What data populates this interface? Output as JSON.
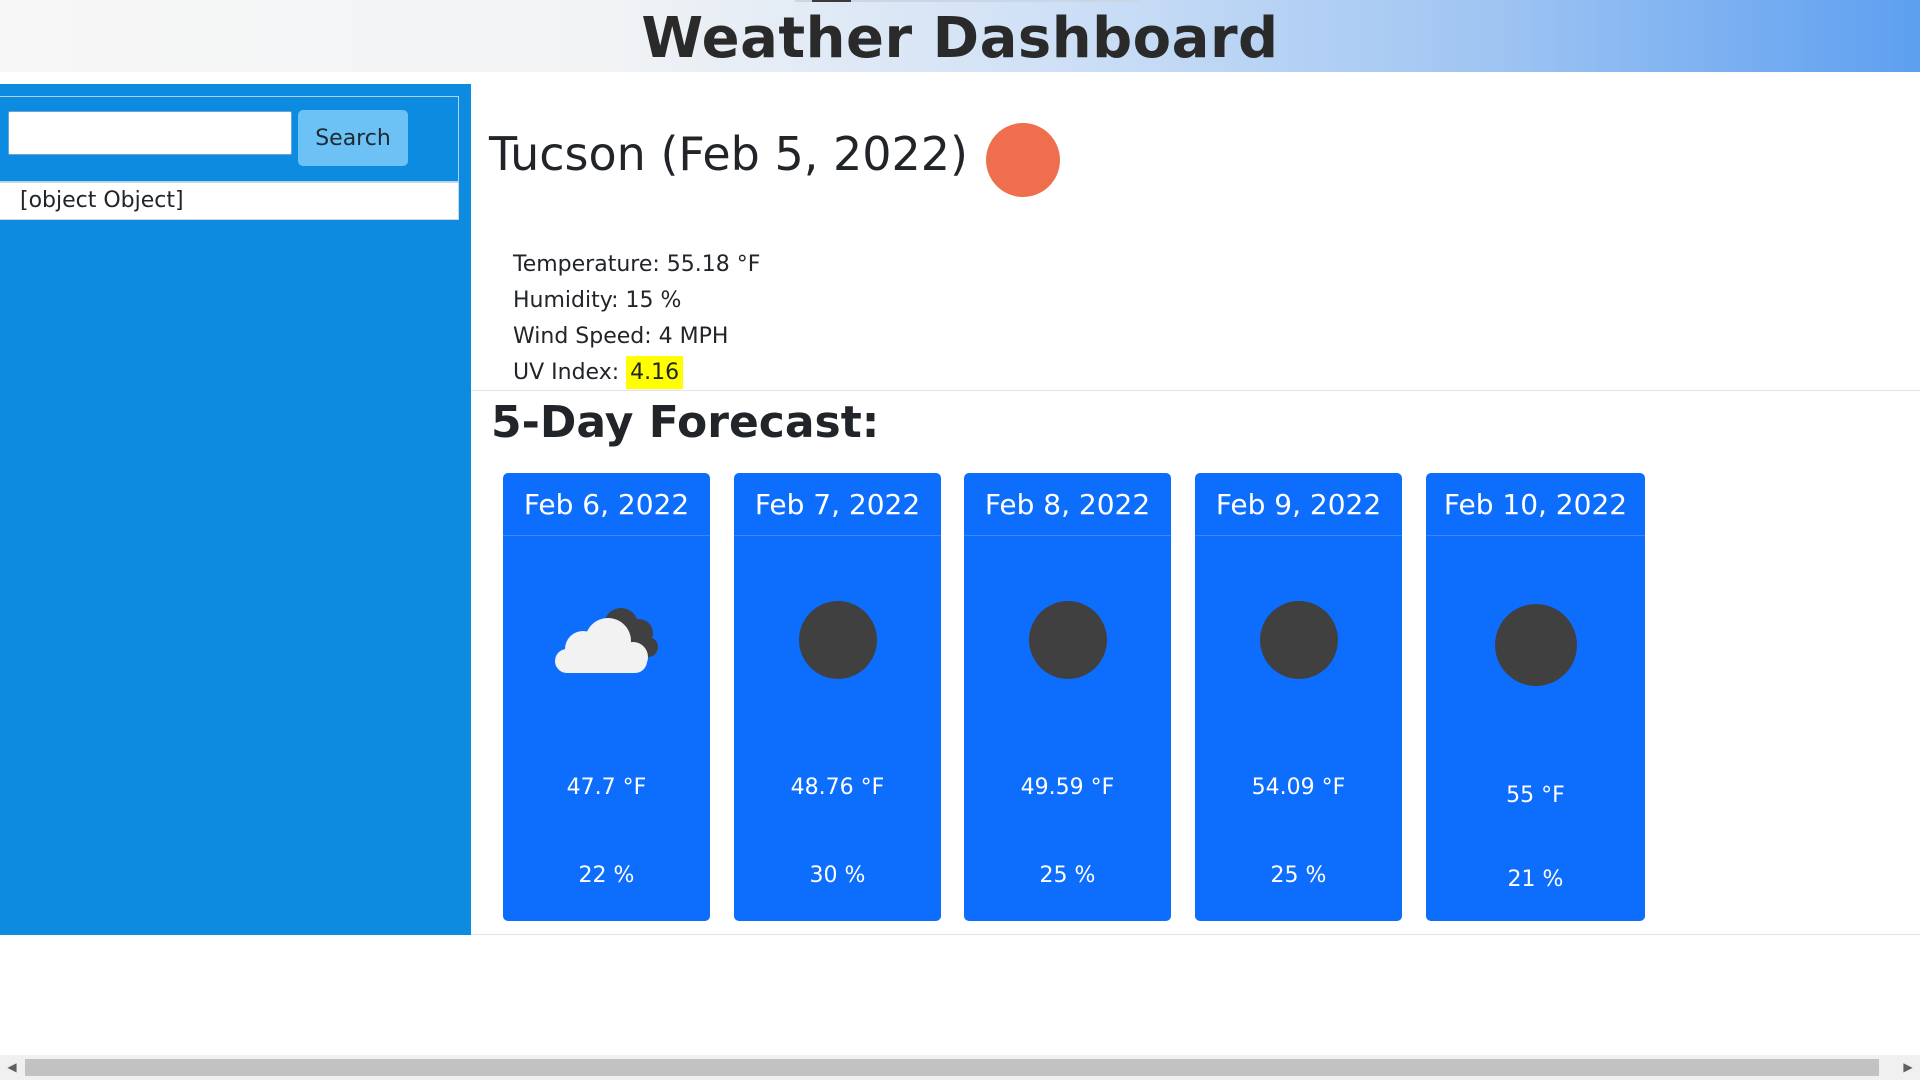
{
  "header": {
    "title": "Weather Dashboard"
  },
  "sidebar": {
    "search": {
      "value": "",
      "placeholder": "",
      "button_label": "Search"
    },
    "history": [
      {
        "label": "[object Object]"
      }
    ]
  },
  "current": {
    "title": "Tucson (Feb 5, 2022)",
    "icon": "sun-icon",
    "icon_color": "#ee6e4d",
    "temperature": "Temperature: 55.18 °F",
    "humidity": "Humidity: 15 %",
    "wind": "Wind Speed: 4 MPH",
    "uv_label": "UV Index: ",
    "uv_value": "4.16",
    "uv_color": "#ffff00"
  },
  "forecast": {
    "heading": "5-Day Forecast:",
    "card_color": "#0d6efd",
    "days": [
      {
        "date": "Feb 6, 2022",
        "icon": "cloudy-icon",
        "temp": "47.7 °F",
        "humidity": "22 %"
      },
      {
        "date": "Feb 7, 2022",
        "icon": "night-icon",
        "temp": "48.76 °F",
        "humidity": "30 %"
      },
      {
        "date": "Feb 8, 2022",
        "icon": "night-icon",
        "temp": "49.59 °F",
        "humidity": "25 %"
      },
      {
        "date": "Feb 9, 2022",
        "icon": "night-icon",
        "temp": "54.09 °F",
        "humidity": "25 %"
      },
      {
        "date": "Feb 10, 2022",
        "icon": "night-icon",
        "temp": "55 °F",
        "humidity": "21 %"
      }
    ]
  },
  "scrollbar": {
    "left_arrow": "◀",
    "right_arrow": "▶"
  }
}
